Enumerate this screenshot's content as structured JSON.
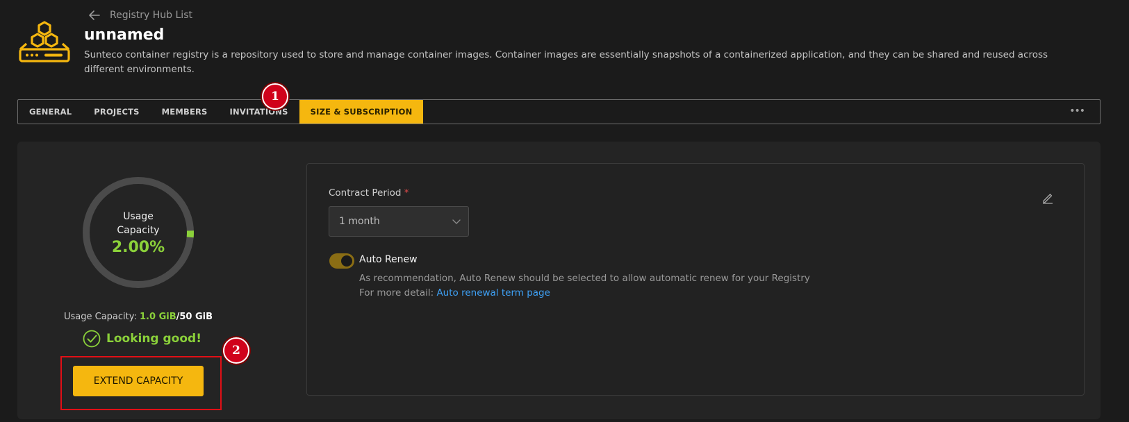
{
  "header": {
    "back_label": "Registry Hub List",
    "title": "unnamed",
    "description": "Sunteco container registry is a repository used to store and manage container images. Container images are essentially snapshots of a containerized application, and they can be shared and reused across different environments."
  },
  "tabs": [
    {
      "label": "GENERAL",
      "active": false
    },
    {
      "label": "PROJECTS",
      "active": false
    },
    {
      "label": "MEMBERS",
      "active": false
    },
    {
      "label": "INVITATIONS",
      "active": false
    },
    {
      "label": "SIZE & SUBSCRIPTION",
      "active": true
    }
  ],
  "tabs_more": "•••",
  "markers": {
    "one": "1",
    "two": "2"
  },
  "usage": {
    "donut_label_line1": "Usage",
    "donut_label_line2": "Capacity",
    "percent_text": "2.00%",
    "percent_value": 2.0,
    "label": "Usage Capacity:",
    "used": "1.0 GiB",
    "separator": "/",
    "total": "50 GiB",
    "status": "Looking good!",
    "extend_button": "EXTEND CAPACITY"
  },
  "subscription": {
    "contract_label": "Contract Period",
    "required_mark": "*",
    "contract_value": "1 month",
    "auto_renew_label": "Auto Renew",
    "auto_renew_on": true,
    "hint_line1": "As recommendation, Auto Renew should be selected to allow automatic renew for your Registry",
    "hint_line2_prefix": "For more detail:",
    "hint_link": "Auto renewal term page"
  },
  "colors": {
    "accent": "#f5b70f",
    "success": "#8bd13a",
    "link": "#3ea0f4",
    "marker": "#d0021b"
  }
}
